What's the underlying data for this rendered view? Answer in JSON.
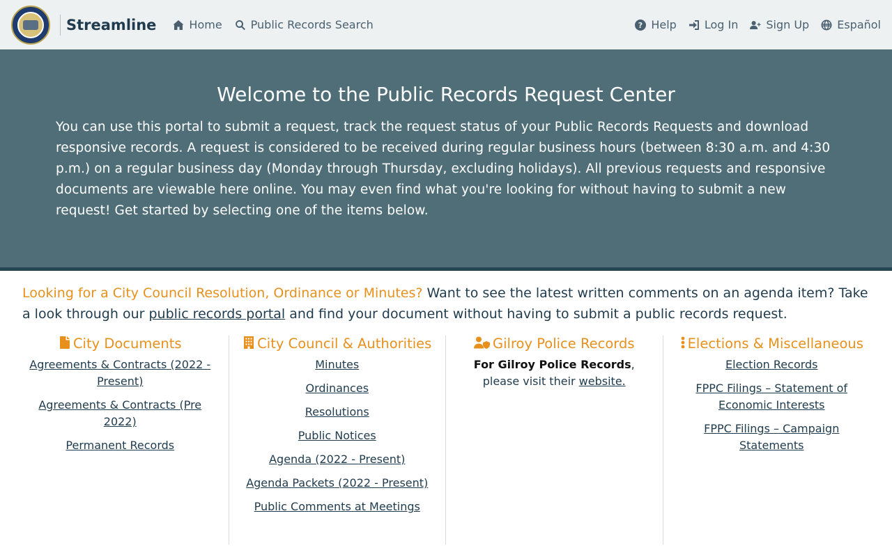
{
  "nav": {
    "brand": "Streamline",
    "left": [
      {
        "label": "Home",
        "icon": "home-icon"
      },
      {
        "label": "Public Records Search",
        "icon": "search-icon"
      }
    ],
    "right": [
      {
        "label": "Help",
        "icon": "help-icon"
      },
      {
        "label": "Log In",
        "icon": "login-icon"
      },
      {
        "label": "Sign Up",
        "icon": "user-plus-icon"
      },
      {
        "label": "Español",
        "icon": "globe-icon"
      }
    ]
  },
  "hero": {
    "title": "Welcome to the Public Records Request Center",
    "body": "You can use this portal to submit a request, track the request status of your Public Records Requests and download responsive records. A request is considered to be received during regular business hours (between 8:30 a.m. and 4:30 p.m.) on a regular business day (Monday through Thursday, excluding holidays). All previous requests and responsive documents are viewable here online. You may even find what you're looking for without having to submit a new request! Get started by selecting one of the items below."
  },
  "notice": {
    "accent": "Looking for a City Council Resolution, Ordinance or Minutes?",
    "text_before": " Want to see the latest written comments on an agenda item? Take a look through our ",
    "link": "public records portal",
    "text_after": " and find your document without having to submit a public records request."
  },
  "columns": {
    "city_docs": {
      "title": "City Documents",
      "links": [
        "Agreements & Contracts (2022 - Present)",
        "Agreements & Contracts (Pre 2022)",
        "Permanent Records"
      ]
    },
    "council": {
      "title": "City Council & Authorities",
      "links": [
        "Minutes",
        "Ordinances",
        "Resolutions",
        "Public Notices",
        "Agenda (2022 - Present)",
        "Agenda Packets (2022 - Present)",
        "Public Comments at Meetings"
      ]
    },
    "police": {
      "title": "Gilroy Police Records",
      "bold": "For Gilroy Police Records",
      "text": ", please visit their ",
      "link": "website."
    },
    "elections": {
      "title": "Elections & Miscellaneous",
      "links": [
        "Election Records",
        "FPPC Filings – Statement of Economic Interests",
        "FPPC Filings – Campaign Statements"
      ]
    }
  },
  "colors": {
    "accent": "#e8901c",
    "hero_bg": "#4f6e78",
    "navy": "#1f3b4d",
    "nav_bg": "#eef1f2"
  }
}
